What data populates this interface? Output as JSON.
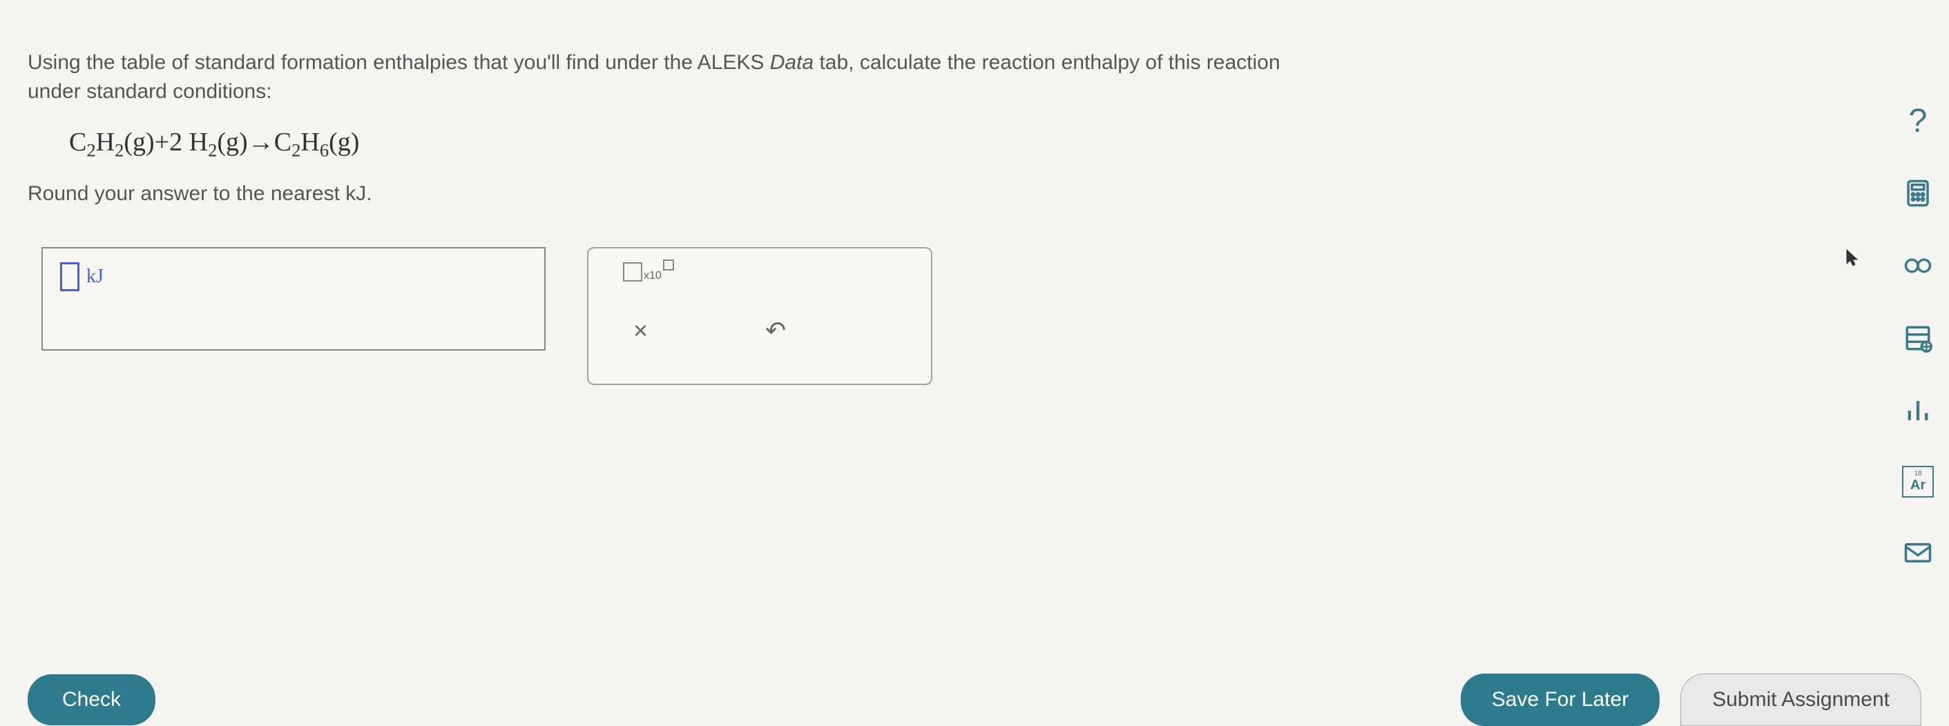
{
  "question": {
    "line1_prefix": "Using the table of standard formation enthalpies that you'll find under the ALEKS ",
    "line1_italic": "Data",
    "line1_suffix": " tab, calculate the reaction enthalpy of this reaction",
    "line2": "under standard conditions:",
    "round_instruction": "Round your answer to the nearest kJ."
  },
  "equation": {
    "reactant1": "C",
    "r1_sub1": "2",
    "r1_h": "H",
    "r1_sub2": "2",
    "r1_phase": "(g)",
    "plus": "+",
    "coef2": "2",
    "r2_h": "H",
    "r2_sub": "2",
    "r2_phase": "(g)",
    "arrow": "→",
    "product": "C",
    "p_sub1": "2",
    "p_h": "H",
    "p_sub2": "6",
    "p_phase": "(g)"
  },
  "answer": {
    "unit": "kJ"
  },
  "tools": {
    "sci_label": "x10",
    "clear": "×",
    "undo": "↶"
  },
  "footer": {
    "check": "Check",
    "save": "Save For Later",
    "submit": "Submit Assignment"
  },
  "sidebar": {
    "help": "?",
    "ar_num": "18",
    "ar_text": "Ar"
  }
}
